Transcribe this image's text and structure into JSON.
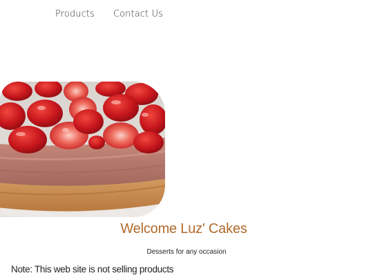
{
  "nav": {
    "items": [
      {
        "label": "Products"
      },
      {
        "label": "Contact Us"
      }
    ]
  },
  "hero": {
    "image": "strawberry-cake-photo"
  },
  "main": {
    "title": "Welcome Luz' Cakes",
    "tagline": "Desserts for any occasion",
    "note": "Note: This web site is not selling products"
  },
  "colors": {
    "title": "#b06a2c",
    "text": "#222222",
    "background": "#ffffff"
  }
}
